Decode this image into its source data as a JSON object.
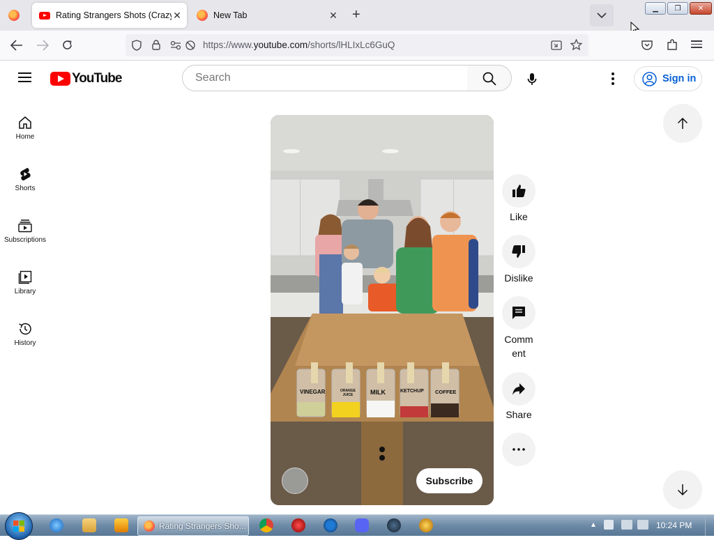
{
  "browser": {
    "tabs": [
      {
        "title": "Rating Strangers Shots (Crazy F",
        "active": true,
        "favicon": "youtube-icon"
      },
      {
        "title": "New Tab",
        "active": false,
        "favicon": "firefox-icon"
      }
    ],
    "url_prefix": "https://www.",
    "url_domain": "youtube.com",
    "url_path": "/shorts/lHLIxLc6GuQ"
  },
  "youtube": {
    "logo_text": "YouTube",
    "search_placeholder": "Search",
    "sign_in_label": "Sign in",
    "sidebar": [
      {
        "label": "Home",
        "icon": "home-icon"
      },
      {
        "label": "Shorts",
        "icon": "shorts-icon"
      },
      {
        "label": "Subscriptions",
        "icon": "subscriptions-icon"
      },
      {
        "label": "Library",
        "icon": "library-icon"
      },
      {
        "label": "History",
        "icon": "history-icon"
      }
    ],
    "short": {
      "subscribe_label": "Subscribe",
      "cup_labels": [
        "VINEGAR",
        "ORANGE JUICE",
        "MILK",
        "KETCHUP",
        "COFFEE"
      ]
    },
    "actions": [
      {
        "label": "Like",
        "icon": "thumbs-up-icon"
      },
      {
        "label": "Dislike",
        "icon": "thumbs-down-icon"
      },
      {
        "label": "Comm\nent",
        "icon": "comment-icon"
      },
      {
        "label": "Share",
        "icon": "share-icon"
      },
      {
        "label": "",
        "icon": "more-icon"
      }
    ]
  },
  "taskbar": {
    "active_task": "Rating Strangers Sho...",
    "clock": "10:24 PM"
  },
  "colors": {
    "yt_red": "#ff0000",
    "link_blue": "#065fd4"
  }
}
